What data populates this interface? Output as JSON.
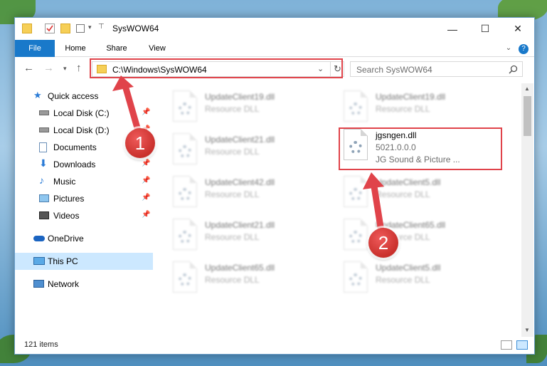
{
  "window": {
    "title": "SysWOW64"
  },
  "ribbon": {
    "tabs": [
      "File",
      "Home",
      "Share",
      "View"
    ]
  },
  "navbar": {
    "address": "C:\\Windows\\SysWOW64",
    "search_placeholder": "Search SysWOW64"
  },
  "sidebar": {
    "items": [
      {
        "label": "Quick access",
        "icon": "star-icon"
      },
      {
        "label": "Local Disk (C:)",
        "icon": "drive-icon"
      },
      {
        "label": "Local Disk (D:)",
        "icon": "drive-icon"
      },
      {
        "label": "Documents",
        "icon": "documents-icon"
      },
      {
        "label": "Downloads",
        "icon": "download-icon"
      },
      {
        "label": "Music",
        "icon": "music-icon"
      },
      {
        "label": "Pictures",
        "icon": "pictures-icon"
      },
      {
        "label": "Videos",
        "icon": "videos-icon"
      },
      {
        "label": "OneDrive",
        "icon": "cloud-icon"
      },
      {
        "label": "This PC",
        "icon": "computer-icon"
      },
      {
        "label": "Network",
        "icon": "network-icon"
      }
    ]
  },
  "files": [
    {
      "name": "UpdateClient19.dll",
      "desc": "Resource DLL"
    },
    {
      "name": "UpdateClient19.dll",
      "desc": "Resource DLL"
    },
    {
      "name": "UpdateClient21.dll",
      "desc": "Resource DLL"
    },
    {
      "name": "jgsngen.dll",
      "desc": "5021.0.0.0",
      "desc2": "JG Sound & Picture ..."
    },
    {
      "name": "UpdateClient42.dll",
      "desc": "Resource DLL"
    },
    {
      "name": "UpdateClient5.dll",
      "desc": "Resource DLL"
    },
    {
      "name": "UpdateClient21.dll",
      "desc": "Resource DLL"
    },
    {
      "name": "UpdateClient65.dll",
      "desc": "Resource DLL"
    },
    {
      "name": "UpdateClient65.dll",
      "desc": "Resource DLL"
    },
    {
      "name": "UpdateClient5.dll",
      "desc": "Resource DLL"
    }
  ],
  "status": {
    "item_count": "121 items"
  },
  "annotations": {
    "step1": "1",
    "step2": "2"
  },
  "colors": {
    "accent": "#1979ca",
    "highlight": "#e0434a",
    "selected": "#cce8ff"
  }
}
